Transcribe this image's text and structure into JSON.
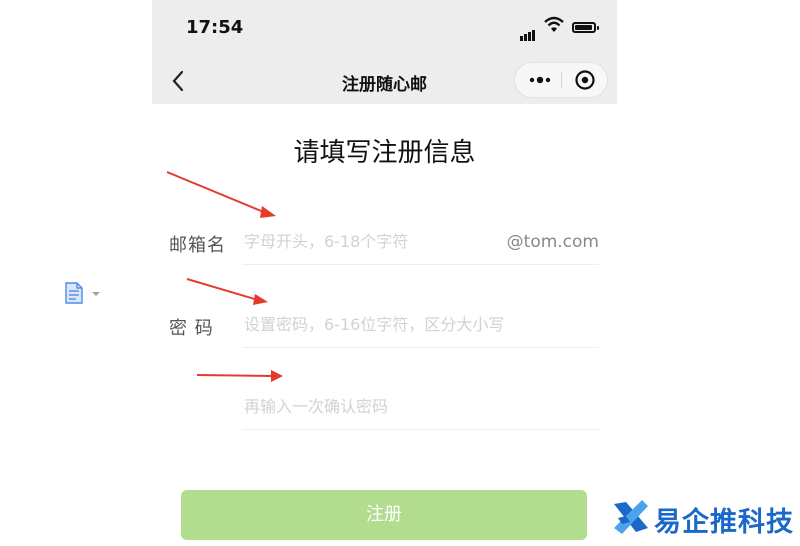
{
  "status_bar": {
    "time": "17:54"
  },
  "nav": {
    "title": "注册随心邮"
  },
  "form": {
    "title": "请填写注册信息",
    "email": {
      "label": "邮箱名",
      "placeholder": "字母开头，6-18个字符",
      "suffix": "@tom.com"
    },
    "password": {
      "label": "密 码",
      "placeholder": "设置密码，6-16位字符，区分大小写"
    },
    "confirm": {
      "placeholder": "再输入一次确认密码"
    },
    "submit_label": "注册"
  },
  "watermark": {
    "text": "易企推科技"
  },
  "icons": {
    "back": "chevron-left-icon",
    "more": "more-dots-icon",
    "close": "target-close-icon",
    "side": "document-icon",
    "brand": "brand-logo-icon"
  },
  "colors": {
    "nav_bg": "#ededed",
    "submit_bg": "#b2dc8e",
    "arrow": "#e53b2c",
    "brand": "#1a68c9"
  }
}
